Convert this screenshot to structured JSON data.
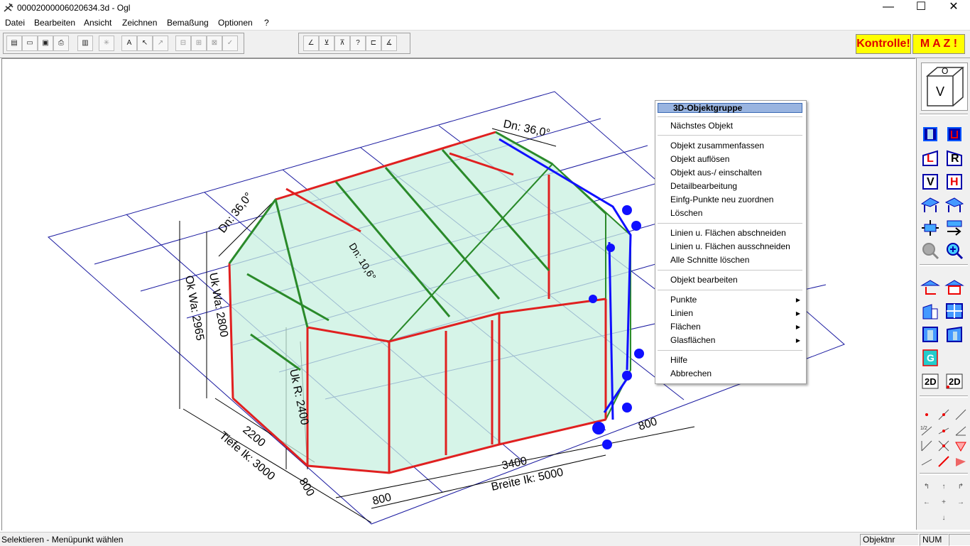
{
  "window": {
    "title": "00002000006020634.3d - Ogl",
    "minimize": "—",
    "maximize": "☐",
    "close": "✕"
  },
  "menu": [
    "Datei",
    "Bearbeiten",
    "Ansicht",
    "Zeichnen",
    "Bemaßung",
    "Optionen",
    "?"
  ],
  "toolbar": {
    "kontrolle_label": "Kontrolle!",
    "maz_label": "M A Z !"
  },
  "context_menu": {
    "header": "3D-Objektgruppe",
    "items": [
      "Nächstes Objekt",
      "Objekt zusammenfassen",
      "Objekt auflösen",
      "Objekt aus-/ einschalten",
      "Detailbearbeitung",
      "Einfg-Punkte neu zuordnen",
      "Löschen",
      "Linien u. Flächen abschneiden",
      "Linien u. Flächen ausschneiden",
      "Alle Schnitte löschen",
      "Objekt bearbeiten",
      "Punkte",
      "Linien",
      "Flächen",
      "Glasflächen",
      "Hilfe",
      "Abbrechen"
    ],
    "submenu_arrow": "▶"
  },
  "drawing": {
    "dims": {
      "dn_right": "Dn: 36,0°",
      "dn_left": "Dn: 36,0°",
      "dn_mid": "Dn: 10,6°",
      "ok_wa": "Ok Wa: 2965",
      "uk_wa": "Uk Wa: 2800",
      "ur_r": "Uk R: 2400",
      "d2200": "2200",
      "tiefe": "Tiefe Ik: 3000",
      "d800a": "800",
      "d800b": "800",
      "d800c": "800",
      "d3400": "3400",
      "breite": "Breite Ik: 5000"
    }
  },
  "rightpanel": {
    "view_cube_top": "O",
    "view_cube_front": "V",
    "btn_l": "L",
    "btn_r": "R",
    "btn_v": "V",
    "btn_h": "H",
    "btn_g": "G",
    "btn_2d_a": "2D",
    "btn_2d_b": "2D"
  },
  "status": {
    "message": "Selektieren - Menüpunkt wählen",
    "objektnr": "Objektnr",
    "num": "NUM"
  },
  "colors": {
    "highlight": "#99b4e0",
    "frame_red": "#e02020",
    "frame_green": "#2a8a2a",
    "glass": "#c8f0e0",
    "grid_blue": "#1a1aa0",
    "select_blue": "#1010ff"
  }
}
